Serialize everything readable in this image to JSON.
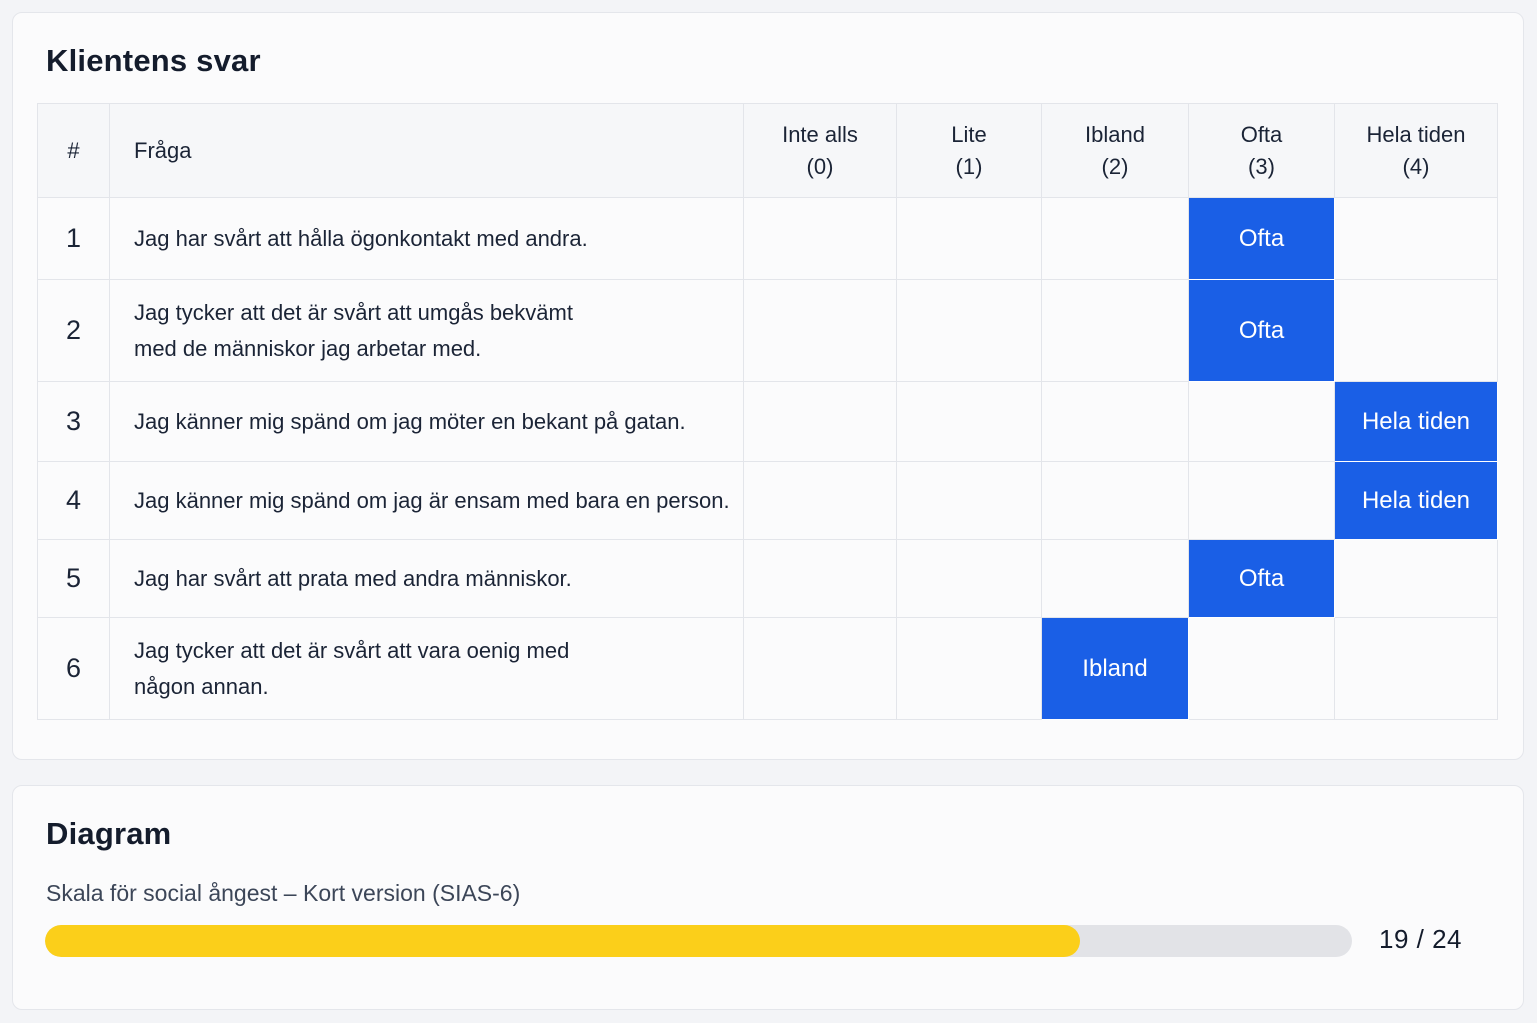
{
  "answers": {
    "title": "Klientens svar",
    "headers": {
      "num": "#",
      "question": "Fråga",
      "options": [
        {
          "label": "Inte alls",
          "value": "(0)"
        },
        {
          "label": "Lite",
          "value": "(1)"
        },
        {
          "label": "Ibland",
          "value": "(2)"
        },
        {
          "label": "Ofta",
          "value": "(3)"
        },
        {
          "label": "Hela tiden",
          "value": "(4)"
        }
      ]
    },
    "rows": [
      {
        "num": "1",
        "question_lines": [
          "Jag har svårt att hålla ögonkontakt med andra."
        ],
        "selected": 3,
        "answer": "Ofta"
      },
      {
        "num": "2",
        "question_lines": [
          "Jag tycker att det är svårt att umgås bekvämt",
          "med de människor jag arbetar med."
        ],
        "selected": 3,
        "answer": "Ofta"
      },
      {
        "num": "3",
        "question_lines": [
          "Jag känner mig spänd om jag möter en bekant på gatan."
        ],
        "selected": 4,
        "answer": "Hela tiden"
      },
      {
        "num": "4",
        "question_lines": [
          "Jag känner mig spänd om jag är ensam med bara en person."
        ],
        "selected": 4,
        "answer": "Hela tiden"
      },
      {
        "num": "5",
        "question_lines": [
          "Jag har svårt att prata med andra människor."
        ],
        "selected": 3,
        "answer": "Ofta"
      },
      {
        "num": "6",
        "question_lines": [
          "Jag tycker att det är svårt att vara oenig med",
          "någon annan."
        ],
        "selected": 2,
        "answer": "Ibland"
      }
    ]
  },
  "diagram": {
    "title": "Diagram",
    "scale_label": "Skala för social ångest – Kort version (SIAS-6)",
    "score": 19,
    "max_score": 24,
    "score_text": "19 / 24",
    "fill_color": "#fbcf1a",
    "track_color": "#e2e3e7"
  },
  "colors": {
    "selected_cell": "#1a5fe6"
  }
}
